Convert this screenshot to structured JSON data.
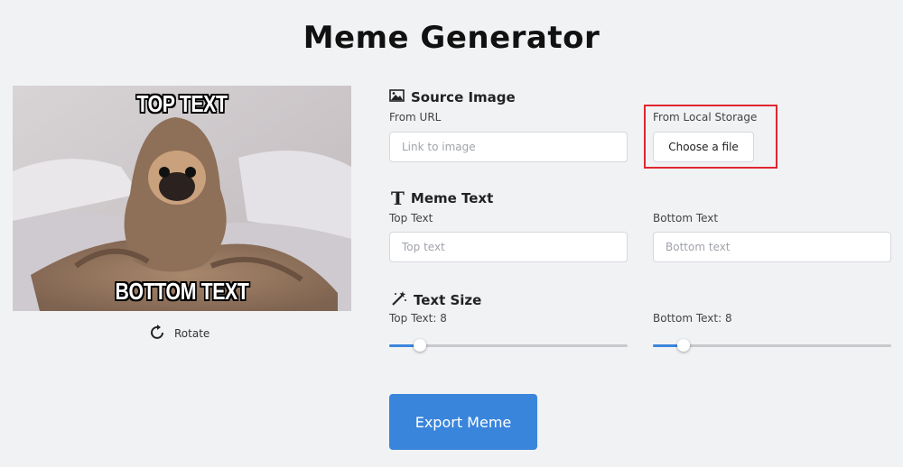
{
  "page": {
    "title": "Meme Generator"
  },
  "preview": {
    "top_text": "TOP TEXT",
    "bottom_text": "BOTTOM TEXT",
    "rotate_label": "Rotate"
  },
  "source": {
    "heading": "Source Image",
    "url_label": "From URL",
    "url_placeholder": "Link to image",
    "local_label": "From Local Storage",
    "choose_file_label": "Choose a file"
  },
  "meme_text": {
    "heading": "Meme Text",
    "top_label": "Top Text",
    "top_placeholder": "Top text",
    "bottom_label": "Bottom Text",
    "bottom_placeholder": "Bottom text"
  },
  "text_size": {
    "heading": "Text Size",
    "top_label": "Top Text: 8",
    "bottom_label": "Bottom Text: 8",
    "top_value": 0.13,
    "bottom_value": 0.13
  },
  "export_label": "Export Meme",
  "colors": {
    "accent": "#3a85dc",
    "highlight": "#e0262f",
    "background": "#f1f2f4"
  },
  "icons": {
    "source": "image-icon",
    "meme_text": "text-t-icon",
    "text_size": "magic-wand-icon",
    "rotate": "rotate-icon"
  }
}
